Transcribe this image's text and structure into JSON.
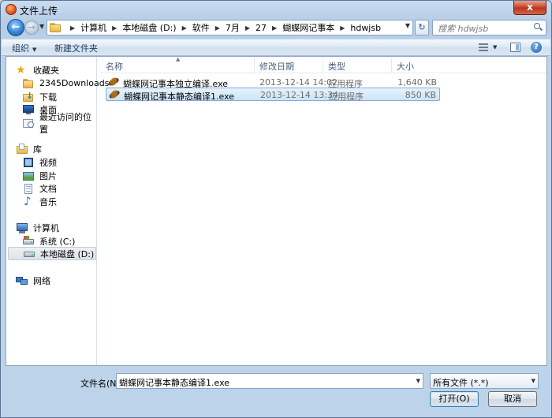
{
  "window": {
    "title": "文件上传",
    "close_label": "x"
  },
  "nav": {
    "back_label": "←",
    "forward_label": "→",
    "breadcrumbs": [
      "计算机",
      "本地磁盘 (D:)",
      "软件",
      "7月",
      "27",
      "蝴蝶网记事本",
      "hdwjsb"
    ],
    "search_placeholder": "搜索 hdwjsb"
  },
  "toolbar": {
    "organize_label": "组织",
    "new_folder_label": "新建文件夹"
  },
  "sidebar": {
    "favorites": {
      "label": "收藏夹",
      "items": [
        "2345Downloads",
        "下载",
        "桌面",
        "最近访问的位置"
      ]
    },
    "libraries": {
      "label": "库",
      "items": [
        "视频",
        "图片",
        "文档",
        "音乐"
      ]
    },
    "computer": {
      "label": "计算机",
      "items": [
        "系统 (C:)",
        "本地磁盘 (D:)"
      ]
    },
    "network": {
      "label": "网络"
    }
  },
  "columns": {
    "name": "名称",
    "modified": "修改日期",
    "type": "类型",
    "size": "大小"
  },
  "files": [
    {
      "name": "蝴蝶网记事本独立编译.exe",
      "modified": "2013-12-14 14:02",
      "type": "应用程序",
      "size": "1,640 KB"
    },
    {
      "name": "蝴蝶网记事本静态编译1.exe",
      "modified": "2013-12-14 13:34",
      "type": "应用程序",
      "size": "850 KB"
    }
  ],
  "bottom": {
    "filename_label": "文件名(N):",
    "filename_value": "蝴蝶网记事本静态编译1.exe",
    "filter_value": "所有文件 (*.*)",
    "open_label": "打开(O)",
    "cancel_label": "取消"
  }
}
